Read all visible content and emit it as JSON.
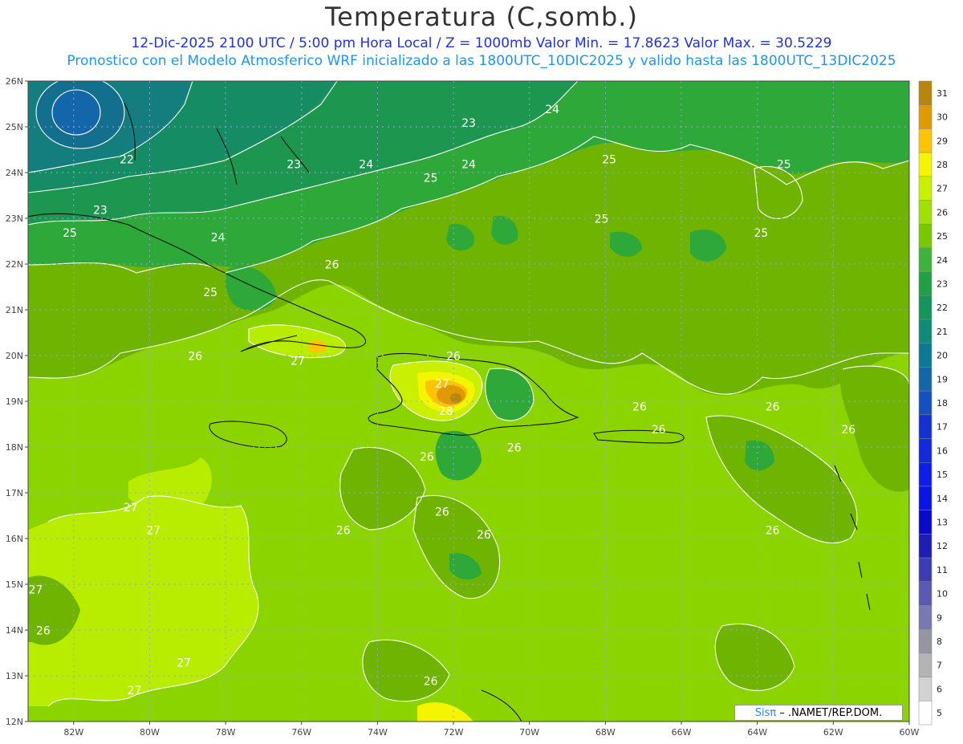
{
  "title": "Temperatura (C,somb.)",
  "subtitle_line1": "12-Dic-2025  2100 UTC / 5:00 pm Hora Local / Z = 1000mb   Valor Min. = 17.8623  Valor Max. = 30.5229",
  "subtitle_line2": "Pronostico con el Modelo Atmosferico WRF inicializado a las 1800UTC_10DIC2025 y valido hasta las  1800UTC_13DIC2025",
  "credit": {
    "brand": "Sisπ",
    "text": "–  .NAMET/REP.DOM."
  },
  "axes": {
    "lat_labels": [
      "26N",
      "25N",
      "24N",
      "23N",
      "22N",
      "21N",
      "20N",
      "19N",
      "18N",
      "17N",
      "16N",
      "15N",
      "14N",
      "13N",
      "12N"
    ],
    "lat_values": [
      26,
      25,
      24,
      23,
      22,
      21,
      20,
      19,
      18,
      17,
      16,
      15,
      14,
      13,
      12
    ],
    "lon_labels": [
      "82W",
      "80W",
      "78W",
      "76W",
      "74W",
      "72W",
      "70W",
      "68W",
      "66W",
      "64W",
      "62W",
      "60W"
    ],
    "lon_values": [
      -82,
      -80,
      -78,
      -76,
      -74,
      -72,
      -70,
      -68,
      -66,
      -64,
      -62,
      -60
    ],
    "lon_range": [
      -83.2,
      -60
    ],
    "lat_range": [
      12,
      26
    ]
  },
  "colorbar": {
    "levels": [
      "31",
      "30",
      "29",
      "28",
      "27",
      "26",
      "25",
      "24",
      "23",
      "22",
      "21",
      "20",
      "19",
      "18",
      "17",
      "16",
      "15",
      "14",
      "13",
      "12",
      "11",
      "10",
      "9",
      "8",
      "7",
      "6",
      "5"
    ],
    "colors": [
      "#b8860b",
      "#e09a00",
      "#ffc400",
      "#f5f500",
      "#c8f000",
      "#a0e000",
      "#78c800",
      "#3cb43c",
      "#22a046",
      "#14965a",
      "#0f8c78",
      "#0f7896",
      "#1466aa",
      "#1450be",
      "#1432d2",
      "#1428dc",
      "#0f1ee6",
      "#0a14e6",
      "#0a0ac8",
      "#1e1eb4",
      "#3c3cb4",
      "#5a5ab4",
      "#7878b4",
      "#9696a0",
      "#b4b4b4",
      "#d2d2d2",
      "#ffffff"
    ]
  },
  "contour_labels": [
    {
      "text": "22",
      "lon": -80.6,
      "lat": 24.2
    },
    {
      "text": "23",
      "lon": -81.3,
      "lat": 23.1
    },
    {
      "text": "23",
      "lon": -76.2,
      "lat": 24.1
    },
    {
      "text": "23",
      "lon": -71.6,
      "lat": 25.0
    },
    {
      "text": "24",
      "lon": -74.3,
      "lat": 24.1
    },
    {
      "text": "24",
      "lon": -71.6,
      "lat": 24.1
    },
    {
      "text": "24",
      "lon": -69.4,
      "lat": 25.3
    },
    {
      "text": "24",
      "lon": -78.2,
      "lat": 22.5
    },
    {
      "text": "25",
      "lon": -82.1,
      "lat": 22.6
    },
    {
      "text": "25",
      "lon": -78.4,
      "lat": 21.3
    },
    {
      "text": "25",
      "lon": -72.6,
      "lat": 23.8
    },
    {
      "text": "25",
      "lon": -67.9,
      "lat": 24.2
    },
    {
      "text": "25",
      "lon": -68.1,
      "lat": 22.9
    },
    {
      "text": "25",
      "lon": -63.9,
      "lat": 22.6
    },
    {
      "text": "25",
      "lon": -63.3,
      "lat": 24.1
    },
    {
      "text": "26",
      "lon": -75.2,
      "lat": 21.9
    },
    {
      "text": "26",
      "lon": -78.8,
      "lat": 19.9
    },
    {
      "text": "26",
      "lon": -72.0,
      "lat": 19.9
    },
    {
      "text": "26",
      "lon": -67.1,
      "lat": 18.8
    },
    {
      "text": "26",
      "lon": -66.6,
      "lat": 18.3
    },
    {
      "text": "26",
      "lon": -63.6,
      "lat": 18.8
    },
    {
      "text": "26",
      "lon": -61.6,
      "lat": 18.3
    },
    {
      "text": "26",
      "lon": -70.4,
      "lat": 17.9
    },
    {
      "text": "26",
      "lon": -72.7,
      "lat": 17.7
    },
    {
      "text": "26",
      "lon": -72.3,
      "lat": 16.5
    },
    {
      "text": "26",
      "lon": -74.9,
      "lat": 16.1
    },
    {
      "text": "26",
      "lon": -71.2,
      "lat": 16.0
    },
    {
      "text": "26",
      "lon": -63.6,
      "lat": 16.1
    },
    {
      "text": "26",
      "lon": -82.8,
      "lat": 13.9
    },
    {
      "text": "26",
      "lon": -72.6,
      "lat": 12.8
    },
    {
      "text": "27",
      "lon": -76.1,
      "lat": 19.8
    },
    {
      "text": "27",
      "lon": -72.3,
      "lat": 19.3
    },
    {
      "text": "27",
      "lon": -80.5,
      "lat": 16.6
    },
    {
      "text": "27",
      "lon": -79.9,
      "lat": 16.1
    },
    {
      "text": "27",
      "lon": -83.0,
      "lat": 14.8
    },
    {
      "text": "27",
      "lon": -79.1,
      "lat": 13.2
    },
    {
      "text": "27",
      "lon": -80.4,
      "lat": 12.6
    },
    {
      "text": "28",
      "lon": -72.2,
      "lat": 18.7
    }
  ]
}
